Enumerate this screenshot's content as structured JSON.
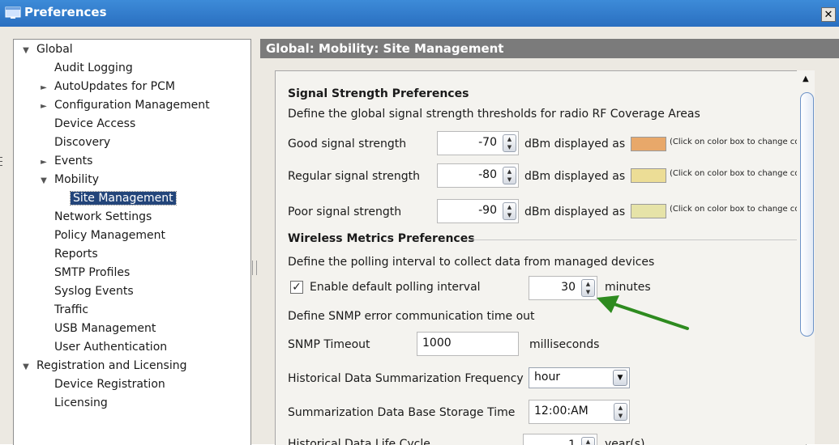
{
  "window": {
    "title": "Preferences",
    "close_glyph": "✕",
    "icon": "app-window-icon"
  },
  "tree": {
    "items": [
      {
        "label": "Global",
        "level": 0,
        "arrow": "▼"
      },
      {
        "label": "Audit Logging",
        "level": 1,
        "arrow": ""
      },
      {
        "label": "AutoUpdates for PCM",
        "level": 1,
        "arrow": "►"
      },
      {
        "label": "Configuration Management",
        "level": 1,
        "arrow": "►"
      },
      {
        "label": "Device Access",
        "level": 1,
        "arrow": ""
      },
      {
        "label": "Discovery",
        "level": 1,
        "arrow": ""
      },
      {
        "label": "Events",
        "level": 1,
        "arrow": "►"
      },
      {
        "label": "Mobility",
        "level": 1,
        "arrow": "▼"
      },
      {
        "label": "Site Management",
        "level": 2,
        "arrow": "",
        "selected": true
      },
      {
        "label": "Network Settings",
        "level": 1,
        "arrow": ""
      },
      {
        "label": "Policy Management",
        "level": 1,
        "arrow": ""
      },
      {
        "label": "Reports",
        "level": 1,
        "arrow": ""
      },
      {
        "label": "SMTP Profiles",
        "level": 1,
        "arrow": ""
      },
      {
        "label": "Syslog Events",
        "level": 1,
        "arrow": ""
      },
      {
        "label": "Traffic",
        "level": 1,
        "arrow": ""
      },
      {
        "label": "USB Management",
        "level": 1,
        "arrow": ""
      },
      {
        "label": "User Authentication",
        "level": 1,
        "arrow": ""
      },
      {
        "label": "Registration and Licensing",
        "level": 0,
        "arrow": "▼"
      },
      {
        "label": "Device Registration",
        "level": 1,
        "arrow": ""
      },
      {
        "label": "Licensing",
        "level": 1,
        "arrow": ""
      }
    ]
  },
  "header": {
    "title": "Global: Mobility: Site Management"
  },
  "signal": {
    "title": "Signal Strength Preferences",
    "description": "Define the global signal strength thresholds for radio RF Coverage Areas",
    "unit_label": "dBm displayed as",
    "hint": "(Click on color box to change co",
    "rows": [
      {
        "label": "Good signal strength",
        "value": "-70",
        "color": "#e8a86a"
      },
      {
        "label": "Regular signal strength",
        "value": "-80",
        "color": "#ecdd96"
      },
      {
        "label": "Poor signal strength",
        "value": "-90",
        "color": "#e6e3a8"
      }
    ]
  },
  "wireless": {
    "title": "Wireless Metrics Preferences",
    "description": "Define the polling interval to collect data from managed devices",
    "enable_label": "Enable default polling interval",
    "enable_checked": "✓",
    "polling_value": "30",
    "polling_unit": "minutes",
    "snmp_description": "Define SNMP error communication time out",
    "snmp_label": "SNMP Timeout",
    "snmp_value": "1000",
    "snmp_unit": "milliseconds",
    "freq_label": "Historical Data Summarization Frequency",
    "freq_value": "hour",
    "storage_label": "Summarization Data Base Storage Time",
    "storage_value": "12:00:AM",
    "lifecycle_label": "Historical Data Life Cycle",
    "lifecycle_value": "1",
    "lifecycle_unit": "year(s)"
  },
  "colors": {
    "annotation_arrow": "#2e8b1f",
    "selection": "#23457a"
  }
}
